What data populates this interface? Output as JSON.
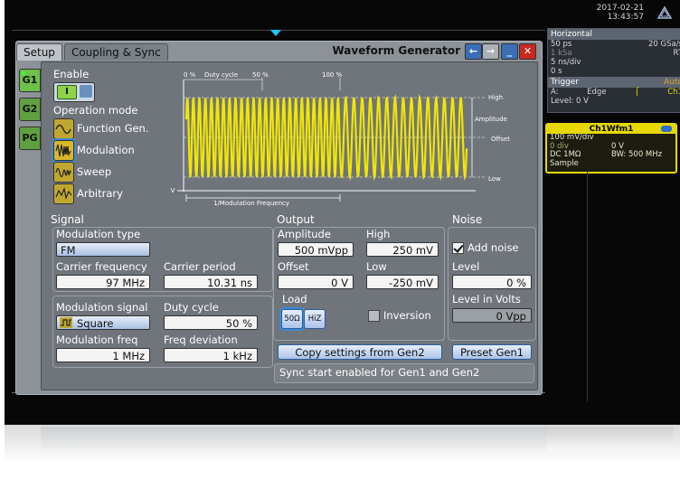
{
  "top": {
    "date": "2017-02-21",
    "time": "13:43:57"
  },
  "horizontal": {
    "title": "Horizontal",
    "rows": [
      [
        "50 ps",
        "20 GSa/s"
      ],
      [
        "1 kSa",
        "RT"
      ],
      [
        "5 ns/div",
        ""
      ],
      [
        "0 s",
        ""
      ]
    ]
  },
  "trigger": {
    "title": "Trigger",
    "mode": "Auto",
    "source_row": [
      "A:",
      "Edge",
      "Ch1"
    ],
    "level": "Level: 0 V"
  },
  "channel": {
    "title": "Ch1Wfm1",
    "rows": [
      [
        "100 mV/div",
        ""
      ],
      [
        "0 div",
        "0 V"
      ],
      [
        "DC 1MΩ",
        "BW: 500 MHz"
      ],
      [
        "Sample",
        ""
      ]
    ]
  },
  "dialog": {
    "tabs": [
      "Setup",
      "Coupling & Sync"
    ],
    "title": "Waveform Generator",
    "side_tabs": [
      "G1",
      "G2",
      "PG"
    ],
    "window_buttons": [
      "back-icon",
      "forward-icon",
      "minimize-icon",
      "close-icon"
    ]
  },
  "enable": {
    "label": "Enable",
    "state": "I"
  },
  "operation_mode": {
    "label": "Operation mode",
    "items": [
      "Function Gen.",
      "Modulation",
      "Sweep",
      "Arbitrary"
    ],
    "selected": "Modulation"
  },
  "diagram": {
    "duty_cycle": "Duty cycle",
    "pct_0": "0 %",
    "pct_50": "50 %",
    "pct_100": "100 %",
    "high": "High",
    "amplitude": "Amplitude",
    "offset": "Offset",
    "low": "Low",
    "zero_v": "0 V",
    "period_label": "1/Modulation Frequency"
  },
  "signal": {
    "section": "Signal",
    "modulation_type_label": "Modulation type",
    "modulation_type": "FM",
    "carrier_frequency_label": "Carrier frequency",
    "carrier_frequency": "97 MHz",
    "carrier_period_label": "Carrier period",
    "carrier_period": "10.31 ns",
    "modulation_signal_label": "Modulation signal",
    "modulation_signal": "Square",
    "duty_cycle_label": "Duty cycle",
    "duty_cycle": "50 %",
    "modulation_freq_label": "Modulation freq",
    "modulation_freq": "1 MHz",
    "freq_deviation_label": "Freq deviation",
    "freq_deviation": "1 kHz"
  },
  "output": {
    "section": "Output",
    "amplitude_label": "Amplitude",
    "amplitude": "500 mVpp",
    "high_label": "High",
    "high": "250 mV",
    "offset_label": "Offset",
    "offset": "0 V",
    "low_label": "Low",
    "low": "-250 mV",
    "load_label": "Load",
    "load_options": [
      "50Ω",
      "HiZ"
    ],
    "load_selected": "50Ω",
    "inversion_label": "Inversion",
    "inversion": false
  },
  "noise": {
    "section": "Noise",
    "add_noise_label": "Add noise",
    "add_noise": true,
    "level_label": "Level",
    "level": "0 %",
    "level_volts_label": "Level in Volts",
    "level_volts": "0 Vpp"
  },
  "actions": {
    "copy_settings": "Copy settings from Gen2",
    "preset": "Preset Gen1",
    "status": "Sync start enabled for Gen1 and Gen2"
  },
  "colors": {
    "signal": "#f2e600",
    "selection": "#3a8ad8",
    "enabled": "#8fd24a",
    "close": "#c8281e"
  }
}
